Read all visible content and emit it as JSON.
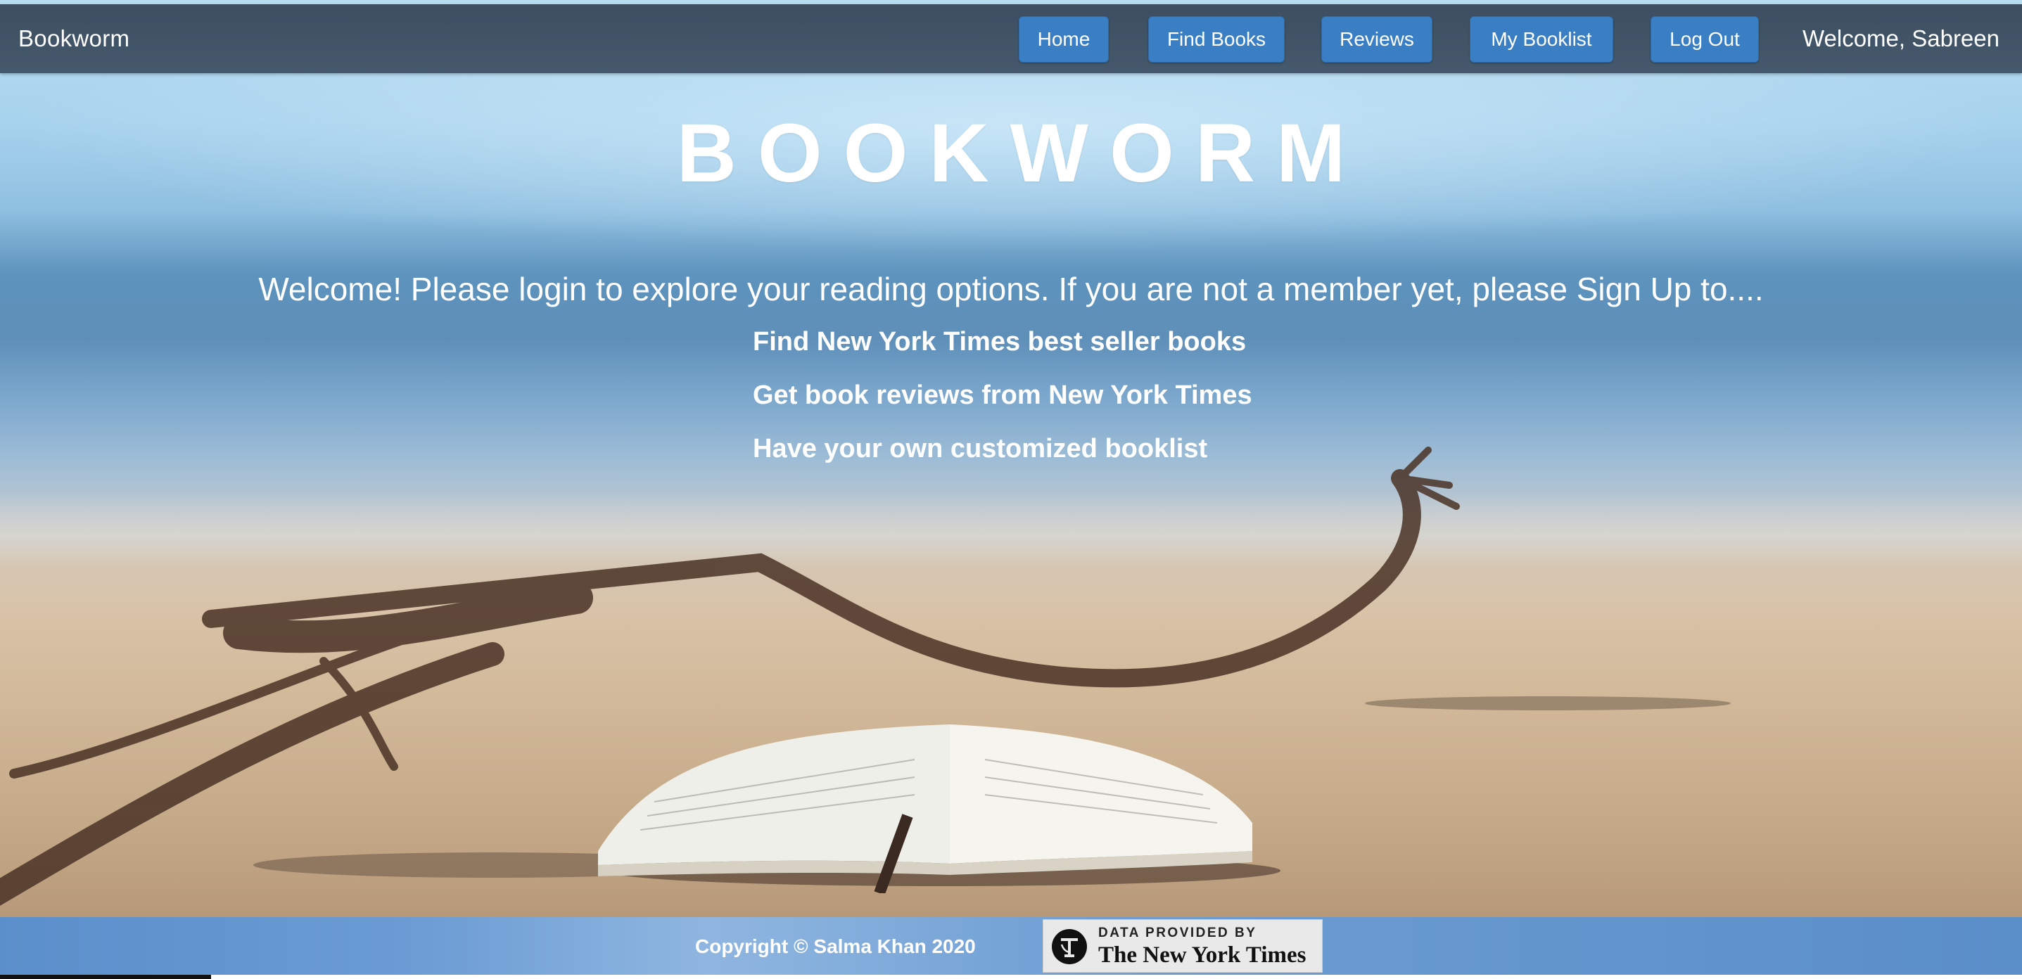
{
  "nav": {
    "brand": "Bookworm",
    "buttons": [
      {
        "label": "Home"
      },
      {
        "label": "Find Books"
      },
      {
        "label": "Reviews"
      },
      {
        "label": "My Booklist"
      },
      {
        "label": "Log Out"
      }
    ],
    "welcome": "Welcome, Sabreen"
  },
  "hero": {
    "title": "BOOKWORM",
    "welcome": "Welcome! Please login to explore your reading options. If you are not a member yet, please Sign Up to....",
    "features": [
      "Find New York Times best seller books",
      "Get book reviews from New York Times",
      "Have your own customized booklist"
    ]
  },
  "footer": {
    "copyright": "Copyright © Salma Khan 2020",
    "badge_small": "DATA PROVIDED BY",
    "badge_title": "The New York Times"
  }
}
